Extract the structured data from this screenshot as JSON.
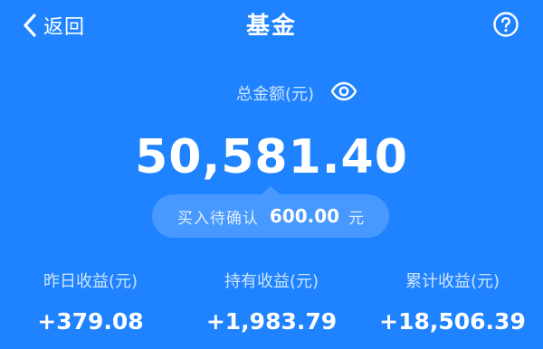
{
  "header": {
    "back_label": "返回",
    "title": "基金",
    "back_icon": "chevron-left-icon",
    "help_icon": "question-circle-icon"
  },
  "summary": {
    "total_label": "总金额(元)",
    "total_amount": "50,581.40",
    "visibility_icon": "eye-icon",
    "pending_label": "买入待确认",
    "pending_amount": "600.00",
    "pending_unit": "元"
  },
  "stats": [
    {
      "label": "昨日收益(元)",
      "value": "+379.08"
    },
    {
      "label": "持有收益(元)",
      "value": "+1,983.79"
    },
    {
      "label": "累计收益(元)",
      "value": "+18,506.39"
    }
  ],
  "colors": {
    "background": "#1f83ff",
    "text": "#ffffff"
  }
}
